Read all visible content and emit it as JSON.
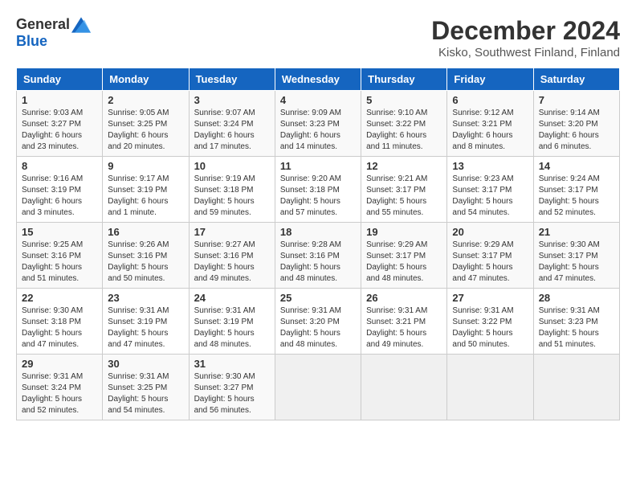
{
  "header": {
    "logo_general": "General",
    "logo_blue": "Blue",
    "title": "December 2024",
    "subtitle": "Kisko, Southwest Finland, Finland"
  },
  "days_of_week": [
    "Sunday",
    "Monday",
    "Tuesday",
    "Wednesday",
    "Thursday",
    "Friday",
    "Saturday"
  ],
  "weeks": [
    [
      {
        "day": 1,
        "sunrise": "9:03 AM",
        "sunset": "3:27 PM",
        "daylight": "6 hours and 23 minutes."
      },
      {
        "day": 2,
        "sunrise": "9:05 AM",
        "sunset": "3:25 PM",
        "daylight": "6 hours and 20 minutes."
      },
      {
        "day": 3,
        "sunrise": "9:07 AM",
        "sunset": "3:24 PM",
        "daylight": "6 hours and 17 minutes."
      },
      {
        "day": 4,
        "sunrise": "9:09 AM",
        "sunset": "3:23 PM",
        "daylight": "6 hours and 14 minutes."
      },
      {
        "day": 5,
        "sunrise": "9:10 AM",
        "sunset": "3:22 PM",
        "daylight": "6 hours and 11 minutes."
      },
      {
        "day": 6,
        "sunrise": "9:12 AM",
        "sunset": "3:21 PM",
        "daylight": "6 hours and 8 minutes."
      },
      {
        "day": 7,
        "sunrise": "9:14 AM",
        "sunset": "3:20 PM",
        "daylight": "6 hours and 6 minutes."
      }
    ],
    [
      {
        "day": 8,
        "sunrise": "9:16 AM",
        "sunset": "3:19 PM",
        "daylight": "6 hours and 3 minutes."
      },
      {
        "day": 9,
        "sunrise": "9:17 AM",
        "sunset": "3:19 PM",
        "daylight": "6 hours and 1 minute."
      },
      {
        "day": 10,
        "sunrise": "9:19 AM",
        "sunset": "3:18 PM",
        "daylight": "5 hours and 59 minutes."
      },
      {
        "day": 11,
        "sunrise": "9:20 AM",
        "sunset": "3:18 PM",
        "daylight": "5 hours and 57 minutes."
      },
      {
        "day": 12,
        "sunrise": "9:21 AM",
        "sunset": "3:17 PM",
        "daylight": "5 hours and 55 minutes."
      },
      {
        "day": 13,
        "sunrise": "9:23 AM",
        "sunset": "3:17 PM",
        "daylight": "5 hours and 54 minutes."
      },
      {
        "day": 14,
        "sunrise": "9:24 AM",
        "sunset": "3:17 PM",
        "daylight": "5 hours and 52 minutes."
      }
    ],
    [
      {
        "day": 15,
        "sunrise": "9:25 AM",
        "sunset": "3:16 PM",
        "daylight": "5 hours and 51 minutes."
      },
      {
        "day": 16,
        "sunrise": "9:26 AM",
        "sunset": "3:16 PM",
        "daylight": "5 hours and 50 minutes."
      },
      {
        "day": 17,
        "sunrise": "9:27 AM",
        "sunset": "3:16 PM",
        "daylight": "5 hours and 49 minutes."
      },
      {
        "day": 18,
        "sunrise": "9:28 AM",
        "sunset": "3:16 PM",
        "daylight": "5 hours and 48 minutes."
      },
      {
        "day": 19,
        "sunrise": "9:29 AM",
        "sunset": "3:17 PM",
        "daylight": "5 hours and 48 minutes."
      },
      {
        "day": 20,
        "sunrise": "9:29 AM",
        "sunset": "3:17 PM",
        "daylight": "5 hours and 47 minutes."
      },
      {
        "day": 21,
        "sunrise": "9:30 AM",
        "sunset": "3:17 PM",
        "daylight": "5 hours and 47 minutes."
      }
    ],
    [
      {
        "day": 22,
        "sunrise": "9:30 AM",
        "sunset": "3:18 PM",
        "daylight": "5 hours and 47 minutes."
      },
      {
        "day": 23,
        "sunrise": "9:31 AM",
        "sunset": "3:19 PM",
        "daylight": "5 hours and 47 minutes."
      },
      {
        "day": 24,
        "sunrise": "9:31 AM",
        "sunset": "3:19 PM",
        "daylight": "5 hours and 48 minutes."
      },
      {
        "day": 25,
        "sunrise": "9:31 AM",
        "sunset": "3:20 PM",
        "daylight": "5 hours and 48 minutes."
      },
      {
        "day": 26,
        "sunrise": "9:31 AM",
        "sunset": "3:21 PM",
        "daylight": "5 hours and 49 minutes."
      },
      {
        "day": 27,
        "sunrise": "9:31 AM",
        "sunset": "3:22 PM",
        "daylight": "5 hours and 50 minutes."
      },
      {
        "day": 28,
        "sunrise": "9:31 AM",
        "sunset": "3:23 PM",
        "daylight": "5 hours and 51 minutes."
      }
    ],
    [
      {
        "day": 29,
        "sunrise": "9:31 AM",
        "sunset": "3:24 PM",
        "daylight": "5 hours and 52 minutes."
      },
      {
        "day": 30,
        "sunrise": "9:31 AM",
        "sunset": "3:25 PM",
        "daylight": "5 hours and 54 minutes."
      },
      {
        "day": 31,
        "sunrise": "9:30 AM",
        "sunset": "3:27 PM",
        "daylight": "5 hours and 56 minutes."
      },
      null,
      null,
      null,
      null
    ]
  ]
}
